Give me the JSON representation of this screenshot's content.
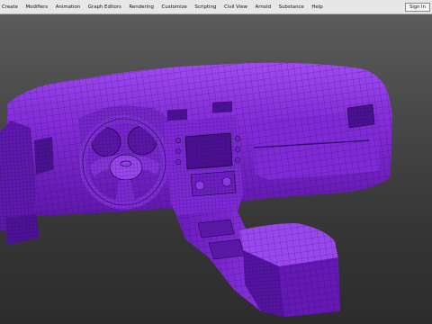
{
  "menubar": {
    "items": [
      "Create",
      "Modifiers",
      "Animation",
      "Graph Editors",
      "Rendering",
      "Customize",
      "Scripting",
      "Civil View",
      "Arnold",
      "Substance",
      "Help"
    ],
    "sign_in": "Sign In"
  },
  "viewport": {
    "object_color": "#8a2cde",
    "wire_color": "#1d0a4a",
    "background_top": "#5b5b5b",
    "background_bottom": "#2c2c2c"
  }
}
